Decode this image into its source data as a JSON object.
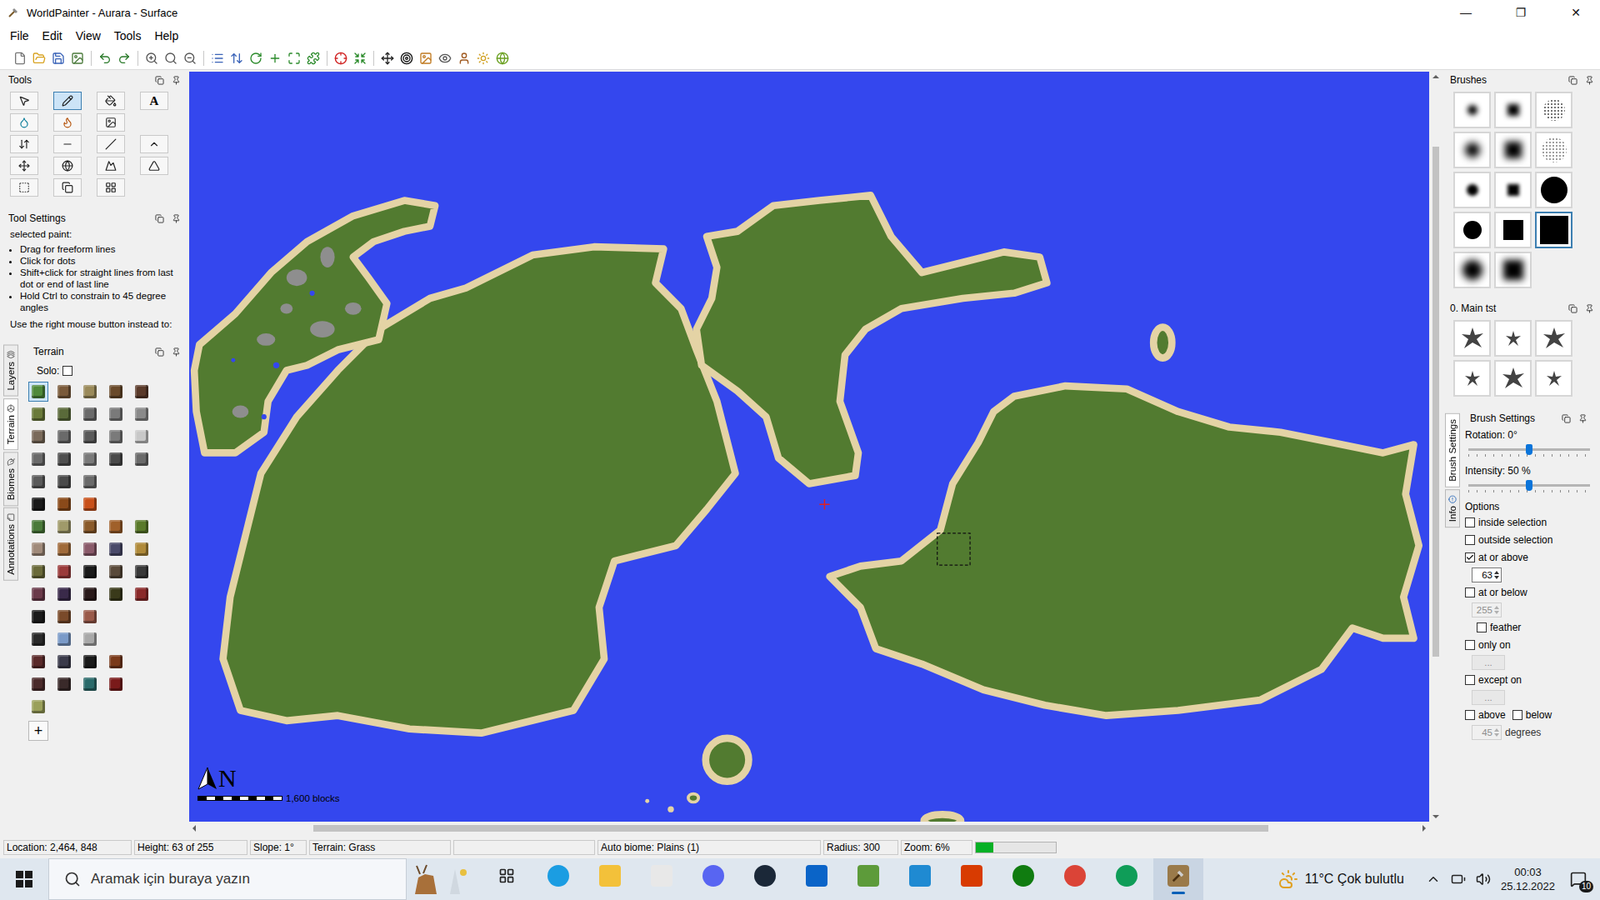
{
  "window": {
    "title": "WorldPainter - Aurara - Surface",
    "controls": [
      "—",
      "❐",
      "✕"
    ]
  },
  "menu": [
    "File",
    "Edit",
    "View",
    "Tools",
    "Help"
  ],
  "tools": {
    "title": "Tools",
    "rows": [
      [
        {
          "selected": false
        },
        {
          "selected": true
        },
        {
          "selected": false
        },
        {
          "selected": false,
          "label": "A"
        }
      ],
      [
        {
          "selected": false
        },
        {
          "selected": false
        },
        {
          "selected": false
        }
      ],
      [
        {
          "selected": false
        },
        {
          "selected": false
        },
        {
          "selected": false
        },
        {
          "selected": false
        }
      ],
      [
        {
          "selected": false
        },
        {
          "selected": false
        },
        {
          "selected": false
        },
        {
          "selected": false
        }
      ],
      [
        {
          "selected": false
        },
        {
          "selected": false
        },
        {
          "selected": false
        }
      ]
    ]
  },
  "tool_settings": {
    "title": "Tool Settings",
    "heading": "selected paint:",
    "bullets": [
      "Drag for freeform lines",
      "Click for dots",
      "Shift+click for straight lines from last dot or end of last line",
      "Hold Ctrl to constrain to 45 degree angles"
    ],
    "footer": "Use the right mouse button instead  to:"
  },
  "left_tabs": [
    {
      "label": "Layers",
      "selected": false
    },
    {
      "label": "Terrain",
      "selected": true
    },
    {
      "label": "Biomes",
      "selected": false
    },
    {
      "label": "Annotations",
      "selected": false
    }
  ],
  "terrain": {
    "title": "Terrain",
    "solo": {
      "label": "Solo:",
      "checked": false
    },
    "rows": [
      [
        {
          "color": "#4f8a3a",
          "selected": true
        },
        {
          "color": "#7a5a3a",
          "selected": false
        },
        {
          "color": "#9a8a5a",
          "selected": false
        },
        {
          "color": "#6a4a2a",
          "selected": false
        },
        {
          "color": "#5a3a2a",
          "selected": false
        }
      ],
      [
        {
          "color": "#6a7a3a",
          "selected": false
        },
        {
          "color": "#5a6a3a",
          "selected": false
        },
        {
          "color": "#6a6a6a",
          "selected": false
        },
        {
          "color": "#7a7a7a",
          "selected": false
        },
        {
          "color": "#8a8a8a",
          "selected": false
        }
      ],
      [
        {
          "color": "#7a6a5a",
          "selected": false
        },
        {
          "color": "#6a6a6a",
          "selected": false
        },
        {
          "color": "#5a5a5a",
          "selected": false
        },
        {
          "color": "#7a7a7a",
          "selected": false
        },
        {
          "color": "#c8c8c8",
          "selected": false
        }
      ],
      [
        {
          "color": "#6a6a6a",
          "selected": false
        },
        {
          "color": "#4f4f4f",
          "selected": false
        },
        {
          "color": "#7a7a7a",
          "selected": false
        },
        {
          "color": "#4a4a4a",
          "selected": false
        },
        {
          "color": "#6a6a6a",
          "selected": false
        }
      ],
      [
        {
          "color": "#5a5a5a",
          "selected": false
        },
        {
          "color": "#4a4a4a",
          "selected": false
        },
        {
          "color": "#6a6a6a",
          "selected": false
        }
      ],
      [
        {
          "color": "#1a1a1a",
          "selected": false
        },
        {
          "color": "#8a4a1a",
          "selected": false
        },
        {
          "color": "#c8501a",
          "selected": false
        }
      ],
      [
        {
          "color": "#4a7a3a",
          "selected": false
        },
        {
          "color": "#a09a6a",
          "selected": false
        },
        {
          "color": "#8a5a2a",
          "selected": false
        },
        {
          "color": "#a0602a",
          "selected": false
        },
        {
          "color": "#5a7a2a",
          "selected": false
        }
      ],
      [
        {
          "color": "#a08a7a",
          "selected": false
        },
        {
          "color": "#a06a3a",
          "selected": false
        },
        {
          "color": "#8a5a6a",
          "selected": false
        },
        {
          "color": "#4a4a6a",
          "selected": false
        },
        {
          "color": "#b08a3a",
          "selected": false
        }
      ],
      [
        {
          "color": "#6a6a3a",
          "selected": false
        },
        {
          "color": "#9a3a3a",
          "selected": false
        },
        {
          "color": "#1a1a1a",
          "selected": false
        },
        {
          "color": "#5a4a3a",
          "selected": false
        },
        {
          "color": "#3a3a3a",
          "selected": false
        }
      ],
      [
        {
          "color": "#6a3a4a",
          "selected": false
        },
        {
          "color": "#3a2a4a",
          "selected": false
        },
        {
          "color": "#2a1a1a",
          "selected": false
        },
        {
          "color": "#3a3a1a",
          "selected": false
        },
        {
          "color": "#8a2a2a",
          "selected": false
        }
      ],
      [
        {
          "color": "#1a1a1a",
          "selected": false
        },
        {
          "color": "#7a4a2a",
          "selected": false
        },
        {
          "color": "#9a5a4a",
          "selected": false
        }
      ],
      [
        {
          "color": "#2a2a2a",
          "selected": false
        },
        {
          "color": "#7a9ac8",
          "selected": false
        },
        {
          "color": "#a8a8a8",
          "selected": false
        }
      ],
      [
        {
          "color": "#5a2a2a",
          "selected": false
        },
        {
          "color": "#3a3a4a",
          "selected": false
        },
        {
          "color": "#1a1a1a",
          "selected": false
        },
        {
          "color": "#7a3a1a",
          "selected": false
        }
      ],
      [
        {
          "color": "#4a2a2a",
          "selected": false
        },
        {
          "color": "#3a2a2a",
          "selected": false
        },
        {
          "color": "#2a6a6a",
          "selected": false
        },
        {
          "color": "#7a1a1a",
          "selected": false
        }
      ],
      [
        {
          "color": "#9aa05a",
          "selected": false
        }
      ]
    ],
    "add": "+"
  },
  "map": {
    "north": "N",
    "scale": "1,600 blocks",
    "vscroll": {
      "start": 0.1,
      "level": 0.68
    },
    "hscroll": {
      "start": 0.1,
      "level": 0.77
    }
  },
  "brushes": {
    "title": "Brushes",
    "items": [
      {
        "kind": "soft-s",
        "selected": false
      },
      {
        "kind": "pyramid-s",
        "selected": false
      },
      {
        "kind": "noise-s",
        "selected": false
      },
      {
        "kind": "soft-m",
        "selected": false
      },
      {
        "kind": "pyramid-m",
        "selected": false
      },
      {
        "kind": "noise-m",
        "selected": false
      },
      {
        "kind": "soft-dot",
        "selected": false
      },
      {
        "kind": "pyramid-dot",
        "selected": false
      },
      {
        "kind": "disc-l",
        "selected": false
      },
      {
        "kind": "disc-m",
        "selected": false
      },
      {
        "kind": "block-m",
        "selected": false
      },
      {
        "kind": "block-l",
        "selected": true
      },
      {
        "kind": "soft-l",
        "selected": false
      },
      {
        "kind": "pyramid-l",
        "selected": false
      }
    ]
  },
  "custom_brushes": {
    "title": "0. Main tst",
    "items": [
      {
        "selected": false
      },
      {
        "selected": false
      },
      {
        "selected": false
      },
      {
        "selected": false
      },
      {
        "selected": false
      },
      {
        "selected": false
      }
    ]
  },
  "right_tabs": [
    {
      "label": "Brush Settings",
      "selected": true
    },
    {
      "label": "Info",
      "selected": false
    }
  ],
  "brush_settings": {
    "title": "Brush Settings",
    "sliders": [
      {
        "label": "Rotation: 0°",
        "level": 0.5
      },
      {
        "label": "Intensity: 50 %",
        "level": 0.5
      }
    ],
    "options_title": "Options",
    "options": [
      {
        "kind": "check",
        "label": "inside selection",
        "checked": false
      },
      {
        "kind": "check",
        "label": "outside selection",
        "checked": false
      },
      {
        "kind": "check",
        "label": "at or above",
        "checked": true
      },
      {
        "kind": "spinner",
        "value": "63",
        "disabled": false
      },
      {
        "kind": "check",
        "label": "at or below",
        "checked": false
      },
      {
        "kind": "spinner",
        "value": "255",
        "disabled": true
      },
      {
        "kind": "subcheck",
        "label": "feather",
        "checked": false
      },
      {
        "kind": "check",
        "label": "only on",
        "checked": false
      },
      {
        "kind": "button",
        "label": "...",
        "disabled": true
      },
      {
        "kind": "check",
        "label": "except on",
        "checked": false
      },
      {
        "kind": "button",
        "label": "...",
        "disabled": true
      },
      {
        "kind": "pair",
        "items": [
          {
            "label": "above",
            "checked": false
          },
          {
            "label": "below",
            "checked": false
          }
        ]
      },
      {
        "kind": "spinner",
        "value": "45",
        "suffix": "degrees",
        "disabled": true
      }
    ]
  },
  "status_bar": {
    "cells": [
      "Location: 2,464, 848",
      "Height: 63 of 255",
      "Slope: 1°",
      "Terrain: Grass",
      "",
      "Auto biome: Plains (1)",
      "Radius: 300",
      "Zoom: 6%"
    ],
    "progress": {
      "level": 0.22
    }
  },
  "taskbar": {
    "search": {
      "placeholder": "Aramak için buraya yazın"
    },
    "apps": [
      {
        "active": false
      },
      {
        "active": false
      },
      {
        "active": false
      },
      {
        "active": false
      },
      {
        "active": false
      },
      {
        "active": false
      },
      {
        "active": false
      },
      {
        "active": false
      },
      {
        "active": false
      },
      {
        "active": false
      },
      {
        "active": false
      },
      {
        "active": false
      },
      {
        "active": false
      },
      {
        "active": true
      }
    ],
    "weather": "11°C  Çok bulutlu",
    "time": "00:03",
    "date": "25.12.2022",
    "notifications": "10"
  }
}
